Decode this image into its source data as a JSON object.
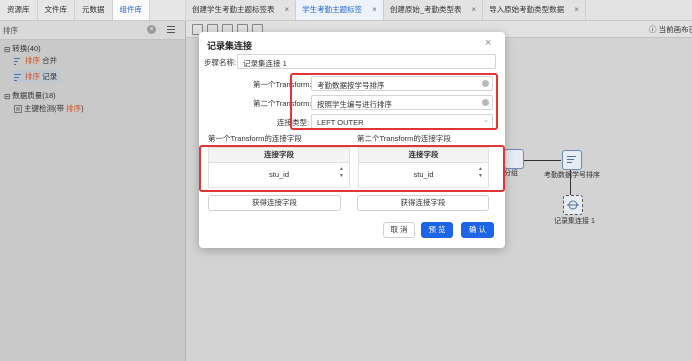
{
  "left_tabs": [
    "资源库",
    "文件库",
    "元数据",
    "组件库"
  ],
  "left_active_tab": 3,
  "search": {
    "value": "排序"
  },
  "tree": {
    "transform_group": "转换(40)",
    "merge_hl": "排序",
    "merge_rest": "合并",
    "record_hl": "排序",
    "record_rest": "记录",
    "quality_group": "数据质量(18)",
    "pk_pre": "主键检测(带",
    "pk_hl": "排序",
    "pk_post": ")"
  },
  "main_tabs": [
    {
      "label": "创建学生考勤主题标签表"
    },
    {
      "label": "学生考勤主题标签"
    },
    {
      "label": "创建原始_考勤类型表"
    },
    {
      "label": "导入原始考勤类型数据"
    }
  ],
  "main_active_tab": 1,
  "tab_close_glyph": "×",
  "toolbar": {
    "canvas_name": "当前画布已"
  },
  "canvas": {
    "step_sort_label": "考勤数据学号排序",
    "step_join_label": "记录集连接 1",
    "step_left_label": "分组"
  },
  "dialog": {
    "title": "记录集连接",
    "close_glyph": "×",
    "step_name_label": "步骤名称:",
    "step_name_value": "记录集连接 1",
    "first_transform_label": "第一个Transform:",
    "first_transform_value": "考勤数据按学号排序",
    "second_transform_label": "第二个Transform:",
    "second_transform_value": "按照学生编号进行排序",
    "join_type_label": "连接类型:",
    "join_type_value": "LEFT OUTER",
    "first_fields_label": "第一个Transform的连接字段",
    "second_fields_label": "第二个Transform的连接字段",
    "table_header": "连接字段",
    "first_field": "stu_id",
    "second_field": "stu_id",
    "get_fields_1": "获得连接字段",
    "get_fields_2": "获得连接字段",
    "cancel": "取 消",
    "preview": "预 览",
    "ok": "确 认"
  },
  "colors": {
    "accent": "#1e64e6",
    "highlight_red": "#e23535",
    "tree_highlight": "#d9541e"
  }
}
